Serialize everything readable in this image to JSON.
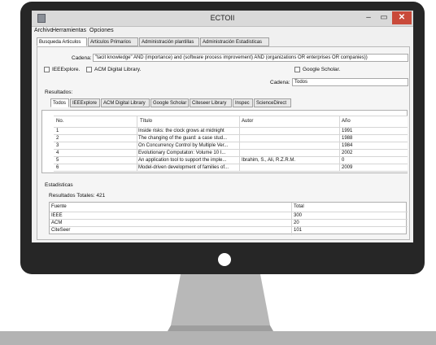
{
  "window": {
    "title": "ECTOII"
  },
  "window_controls": {
    "minimize": "–",
    "maximize": "▭",
    "close": "✕"
  },
  "menu": [
    "Archivo",
    "Herramientas",
    "Opciones"
  ],
  "main_tabs": [
    "Busqueda Articulos",
    "Articulos Primarios",
    "Administración plantillas",
    "Administración Estadisticas"
  ],
  "search": {
    "cadena_label": "Cadena:",
    "cadena_value": "\"tacit knowledge\" AND (importance) and (software process improvement) AND (organizations OR enterprises OR companies))"
  },
  "sources": {
    "ieee": "IEEExplore.",
    "acm": "ACM Digital Library.",
    "google": "Google Scholar."
  },
  "filter": {
    "label": "Cadena:",
    "value": "Todos"
  },
  "results_label": "Resultados:",
  "result_tabs": [
    "Todos",
    "IEEExplore",
    "ACM Digital Library",
    "Google Scholar",
    "Citeseer Library",
    "Inspec",
    "ScienceDirect"
  ],
  "results_table": {
    "headers": [
      "No.",
      "Título",
      "Autor",
      "Año"
    ],
    "rows": [
      [
        "1",
        "Inside risks: the clock grows at midnight",
        "",
        "1991"
      ],
      [
        "2",
        "The changing of the guard: a case stud...",
        "",
        "1988"
      ],
      [
        "3",
        "On Concurrency Control by Multiple Ver...",
        "",
        "1984"
      ],
      [
        "4",
        "Evolutionary Computaton: Volume 10 I...",
        "",
        "2002"
      ],
      [
        "5",
        "An application tool to support the imple...",
        "Ibrahim, S., Ali, R.Z.R.M.",
        "0"
      ],
      [
        "6",
        "Model-driven development of families of...",
        "",
        "2009"
      ]
    ]
  },
  "stats": {
    "section_label": "Estadisticas",
    "total_label": "Resultados Totales: 421",
    "headers": [
      "Fuente",
      "Total"
    ],
    "rows": [
      [
        "IEEE",
        "300"
      ],
      [
        "ACM",
        "20"
      ],
      [
        "CiteSeer",
        "101"
      ]
    ]
  }
}
